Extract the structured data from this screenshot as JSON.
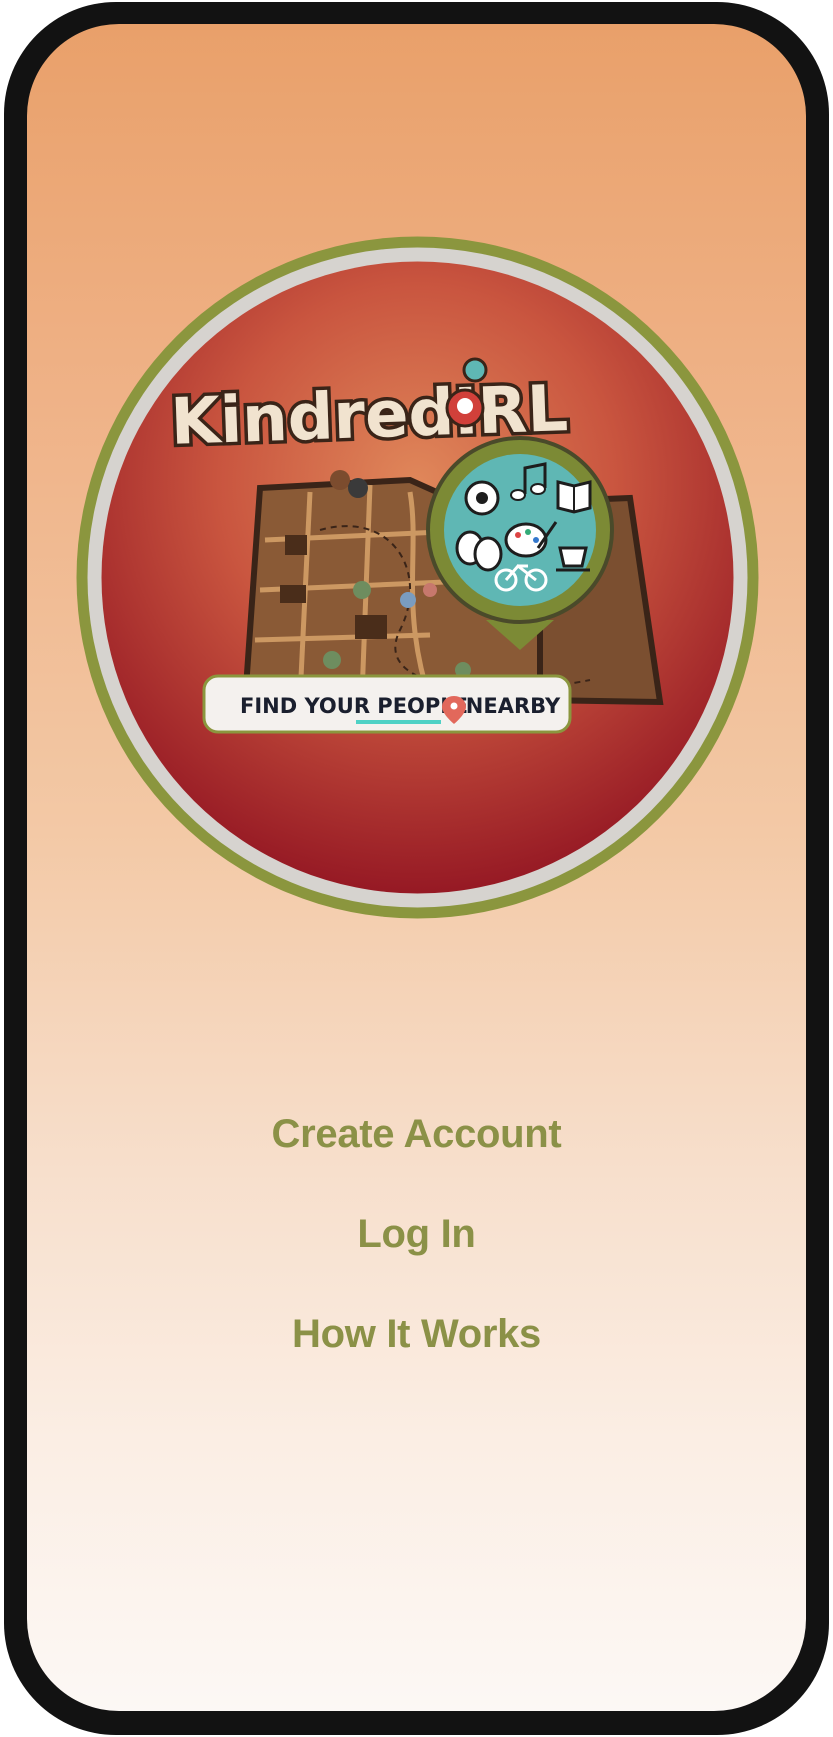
{
  "logo": {
    "brand_name": "KindredIRL",
    "tagline_prefix": "FIND YOUR PEOPLE",
    "tagline_suffix": "NEARBY",
    "colors": {
      "ring_green": "#8b963e",
      "ring_gray": "#d6d3cf",
      "disc_top": "#d8794f",
      "disc_bottom": "#8e1020",
      "map_brown": "#8a5a36",
      "pin_teal": "#5fb7b4",
      "underline_teal": "#4fd1c5",
      "text_dark": "#3a2418"
    },
    "icons": [
      "soccer-ball-icon",
      "music-note-icon",
      "book-icon",
      "theater-masks-icon",
      "palette-icon",
      "coffee-cup-icon",
      "bicycle-icon",
      "location-pin-icon"
    ]
  },
  "menu": {
    "create_account": "Create Account",
    "log_in": "Log In",
    "how_it_works": "How It Works",
    "text_color": "#8b9147"
  },
  "background": {
    "gradient_top": "#e9a06a",
    "gradient_bottom": "#fcf8f5"
  }
}
